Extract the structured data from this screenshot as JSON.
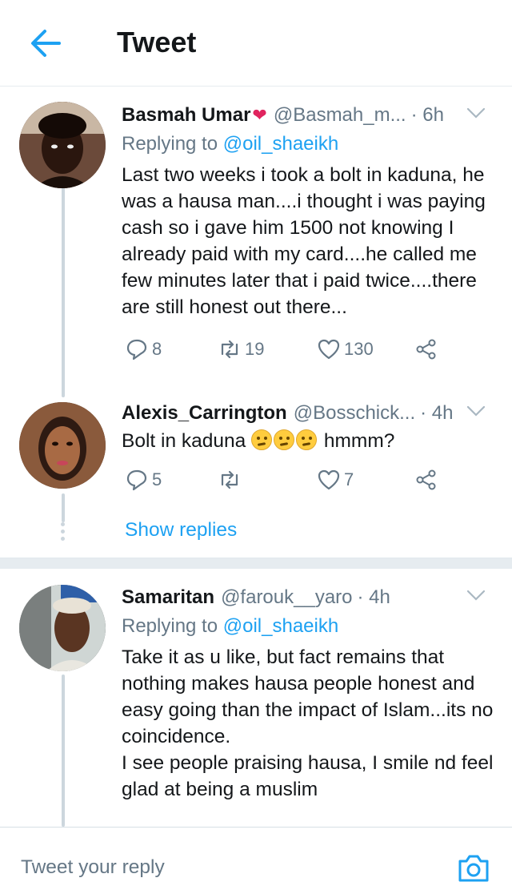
{
  "header": {
    "title": "Tweet"
  },
  "tweets": [
    {
      "name": "Basmah Umar",
      "name_heart": "❤",
      "handle": "@Basmah_m...",
      "time": "· 6h",
      "reply_prefix": "Replying to ",
      "reply_to": "@oil_shaeikh",
      "text": "Last two weeks i took a bolt in kaduna, he was a hausa man....i thought i was paying cash so i gave him 1500 not knowing I already paid with my card....he called me few minutes later that i paid twice....there are still honest out there...",
      "replies": "8",
      "retweets": "19",
      "likes": "130"
    },
    {
      "name": "Alexis_Carrington",
      "handle": "@Bosschick...",
      "time": "· 4h",
      "text_before": "Bolt in kaduna ",
      "text_after": " hmmm?",
      "emoji": "thinking-face",
      "replies": "5",
      "retweets": "",
      "likes": "7"
    },
    {
      "name": "Samaritan",
      "handle": "@farouk__yaro",
      "time": "· 4h",
      "reply_prefix": "Replying to ",
      "reply_to": "@oil_shaeikh",
      "text": "Take it as u like, but fact remains that nothing makes hausa people honest and easy going than the impact of Islam...its no coincidence.",
      "text2": "I see people praising hausa, I smile nd feel glad at being a muslim"
    }
  ],
  "show_replies": "Show replies",
  "composer": {
    "placeholder": "Tweet your reply"
  },
  "colors": {
    "accent": "#1da1f2",
    "secondary_text": "#657786",
    "like": "#e0245e",
    "divider": "#e6ecf0"
  },
  "icons": [
    "back-arrow-icon",
    "chevron-down-icon",
    "reply-icon",
    "retweet-icon",
    "like-icon",
    "share-icon",
    "camera-icon"
  ]
}
